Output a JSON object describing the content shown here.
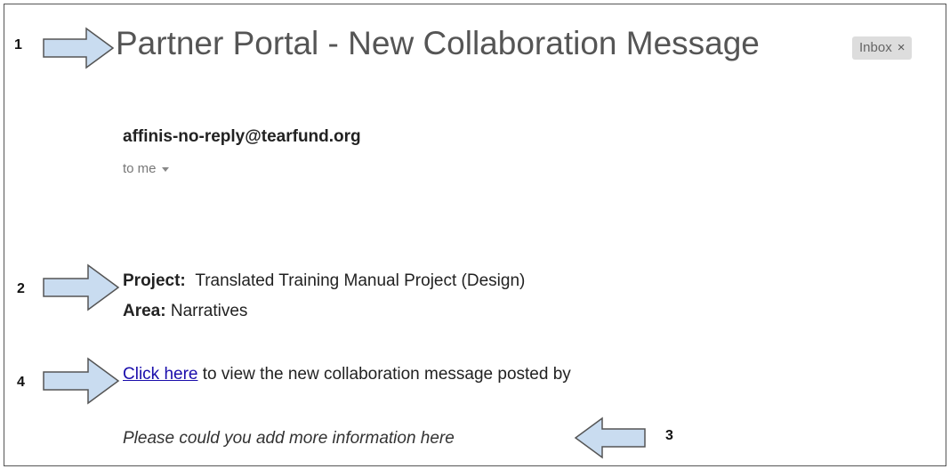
{
  "email": {
    "subject": "Partner Portal - New Collaboration Message",
    "label": "Inbox",
    "label_close": "×",
    "sender": "affinis-no-reply@tearfund.org",
    "recipient": "to me",
    "project_label": "Project:",
    "project_value": "Translated Training Manual Project (Design)",
    "area_label": "Area:",
    "area_value": "Narratives",
    "link_text": "Click here",
    "link_suffix": "to view the new collaboration message posted by",
    "message": "Please could you add more information here"
  },
  "annotations": [
    {
      "number": "1"
    },
    {
      "number": "2"
    },
    {
      "number": "3"
    },
    {
      "number": "4"
    }
  ],
  "colors": {
    "arrow_fill": "#c9dcf0",
    "arrow_stroke": "#555555",
    "link": "#1a0dab",
    "chip_bg": "#dddddd"
  }
}
